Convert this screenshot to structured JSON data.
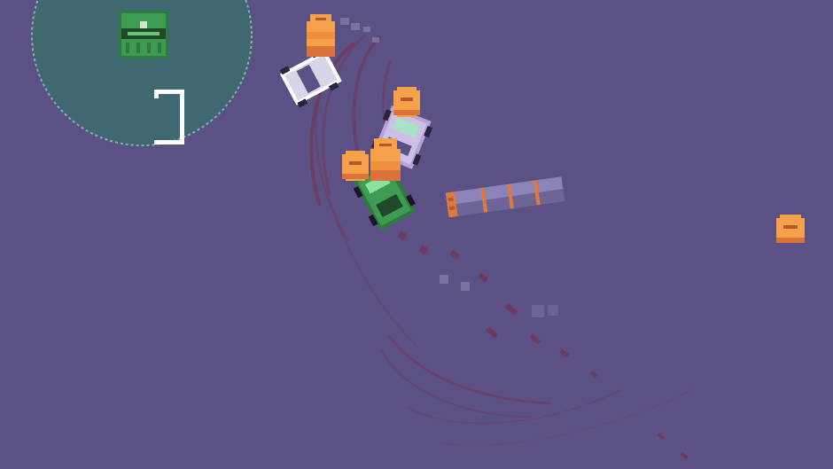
{
  "colors": {
    "ground": "#5c5184",
    "zone": "#3f6870",
    "zone_edge": "#7fb4a8",
    "coin": "#f5a14a",
    "coin_dark": "#d9733a",
    "coin_mark": "#b8562d",
    "skid": "#6e3a5e",
    "player_car": "#3d9b52",
    "white_car": "#d9d4e8",
    "lilac_car": "#b7a2d9",
    "log": "#8c83b8",
    "log_ring": "#e07a3a",
    "chest": "#3d9b52",
    "bracket": "#ffffff"
  },
  "icons": {
    "chest": "treasure-chest-icon",
    "coin": "coin-icon",
    "bracket": "goal-bracket-icon"
  }
}
